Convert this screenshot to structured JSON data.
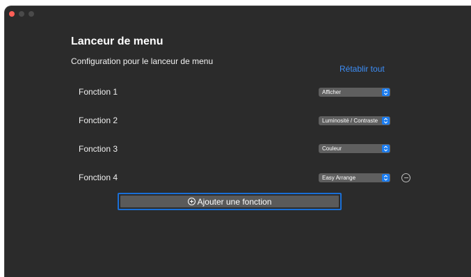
{
  "window": {
    "title": "Lanceur de menu",
    "subtitle": "Configuration pour le lanceur de menu",
    "reset_label": "Rétablir tout"
  },
  "functions": [
    {
      "label": "Fonction 1",
      "value": "Afficher"
    },
    {
      "label": "Fonction 2",
      "value": "Luminosité / Contraste"
    },
    {
      "label": "Fonction 3",
      "value": "Couleur"
    },
    {
      "label": "Fonction 4",
      "value": "Easy Arrange"
    }
  ],
  "add_button_label": "Ajouter une fonction",
  "icons": {
    "remove": "minus-circle-icon",
    "add": "plus-circle-icon",
    "select": "chevron-updown-icon"
  },
  "colors": {
    "accent": "#1a7cf0",
    "link": "#3d8ef7",
    "background": "#2b2b2b"
  }
}
